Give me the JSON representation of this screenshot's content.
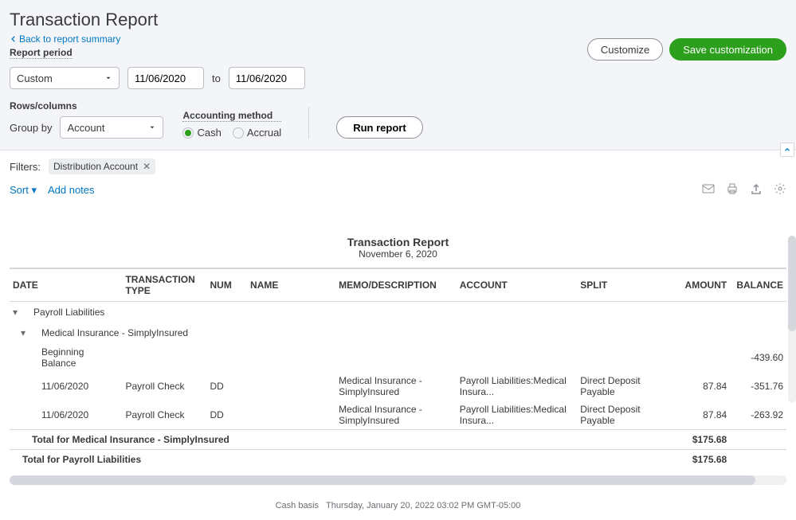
{
  "header": {
    "page_title": "Transaction Report",
    "back_link": "Back to report summary",
    "period_label": "Report period",
    "period_select": "Custom",
    "date_from": "11/06/2020",
    "to_label": "to",
    "date_to": "11/06/2020",
    "customize_btn": "Customize",
    "save_btn": "Save customization"
  },
  "options": {
    "rows_label": "Rows/columns",
    "group_by_label": "Group by",
    "group_by_value": "Account",
    "method_label": "Accounting method",
    "cash_label": "Cash",
    "accrual_label": "Accrual",
    "run_btn": "Run report"
  },
  "filters": {
    "label": "Filters:",
    "chip_text": "Distribution Account"
  },
  "toolbar": {
    "sort": "Sort",
    "notes": "Add notes"
  },
  "report": {
    "title": "Transaction Report",
    "subtitle": "November 6, 2020",
    "columns": [
      "DATE",
      "TRANSACTION TYPE",
      "NUM",
      "NAME",
      "MEMO/DESCRIPTION",
      "ACCOUNT",
      "SPLIT",
      "AMOUNT",
      "BALANCE"
    ],
    "group1": "Payroll Liabilities",
    "group2": "Medical Insurance - SimplyInsured",
    "beginning_label": "Beginning Balance",
    "beginning_balance": "-439.60",
    "rows": [
      {
        "date": "11/06/2020",
        "type": "Payroll Check",
        "num": "DD",
        "name": "",
        "memo": "Medical Insurance - SimplyInsured",
        "account": "Payroll Liabilities:Medical Insura...",
        "split": "Direct Deposit Payable",
        "amount": "87.84",
        "balance": "-351.76"
      },
      {
        "date": "11/06/2020",
        "type": "Payroll Check",
        "num": "DD",
        "name": "",
        "memo": "Medical Insurance - SimplyInsured",
        "account": "Payroll Liabilities:Medical Insura...",
        "split": "Direct Deposit Payable",
        "amount": "87.84",
        "balance": "-263.92"
      }
    ],
    "total2_label": "Total for Medical Insurance - SimplyInsured",
    "total2_amount": "$175.68",
    "total1_label": "Total for Payroll Liabilities",
    "total1_amount": "$175.68"
  },
  "footer": {
    "basis": "Cash basis",
    "timestamp": "Thursday, January 20, 2022   03:02 PM GMT-05:00"
  }
}
